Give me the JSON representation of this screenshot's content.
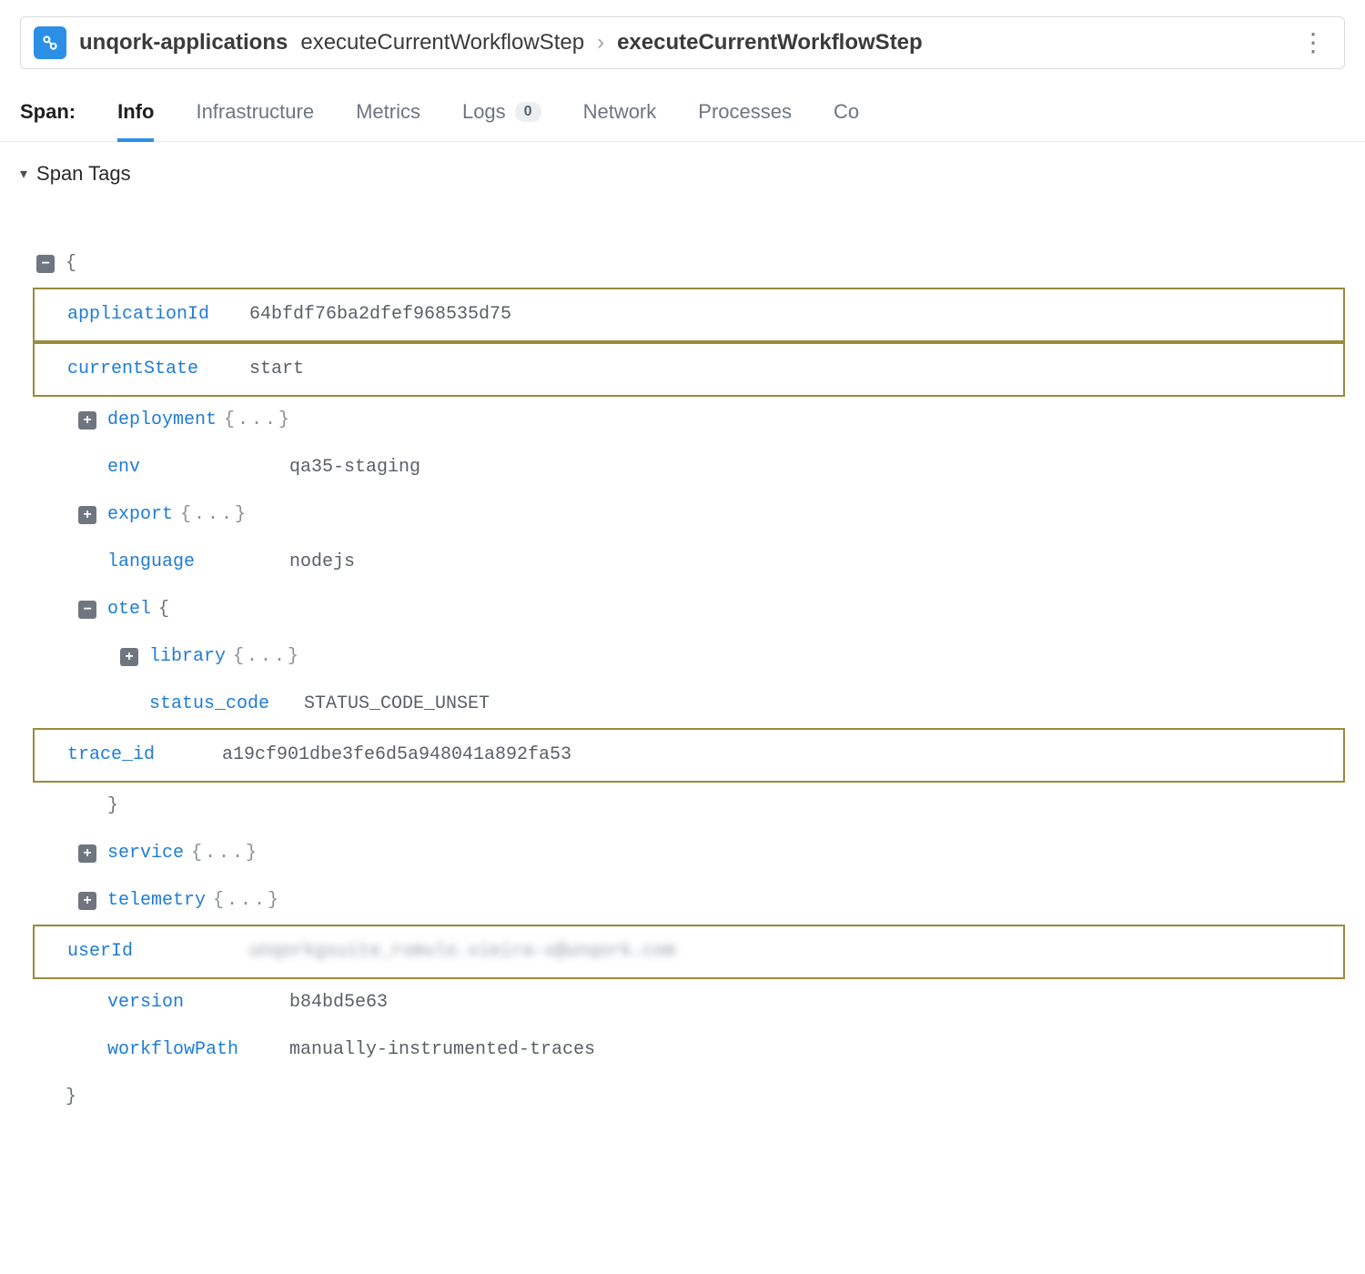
{
  "breadcrumb": {
    "service": "unqork-applications",
    "step1": "executeCurrentWorkflowStep",
    "step2": "executeCurrentWorkflowStep"
  },
  "tabs": {
    "label": "Span:",
    "items": [
      {
        "label": "Info",
        "active": true
      },
      {
        "label": "Infrastructure",
        "active": false
      },
      {
        "label": "Metrics",
        "active": false
      },
      {
        "label": "Logs",
        "active": false,
        "count": "0"
      },
      {
        "label": "Network",
        "active": false
      },
      {
        "label": "Processes",
        "active": false
      },
      {
        "label": "Co",
        "active": false
      }
    ]
  },
  "section": {
    "title": "Span Tags"
  },
  "tags": {
    "applicationId": {
      "key": "applicationId",
      "value": "64bfdf76ba2dfef968535d75"
    },
    "currentState": {
      "key": "currentState",
      "value": "start"
    },
    "deployment": {
      "key": "deployment"
    },
    "env": {
      "key": "env",
      "value": "qa35-staging"
    },
    "export": {
      "key": "export"
    },
    "language": {
      "key": "language",
      "value": "nodejs"
    },
    "otel": {
      "key": "otel",
      "library": {
        "key": "library"
      },
      "status_code": {
        "key": "status_code",
        "value": "STATUS_CODE_UNSET"
      },
      "trace_id": {
        "key": "trace_id",
        "value": "a19cf901dbe3fe6d5a948041a892fa53"
      }
    },
    "service": {
      "key": "service"
    },
    "telemetry": {
      "key": "telemetry"
    },
    "userId": {
      "key": "userId",
      "value": "unqorkgsuite_romulo.vieira-x@unqork.com"
    },
    "version": {
      "key": "version",
      "value": "b84bd5e63"
    },
    "workflowPath": {
      "key": "workflowPath",
      "value": "manually-instrumented-traces"
    }
  },
  "glyphs": {
    "open_brace": "{",
    "close_brace": "}",
    "dots": "{...}"
  }
}
